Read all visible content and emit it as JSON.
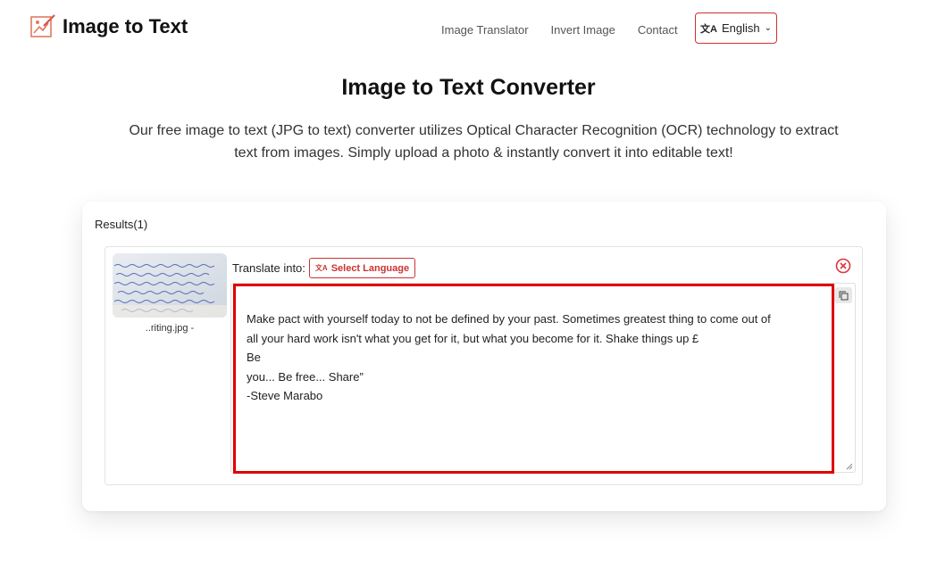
{
  "header": {
    "logo_text": "Image to Text",
    "nav": [
      {
        "label": "Image Translator"
      },
      {
        "label": "Invert Image"
      },
      {
        "label": "Contact"
      }
    ],
    "language_button": "English"
  },
  "main": {
    "title": "Image to Text Converter",
    "description": "Our free image to text (JPG to text) converter utilizes Optical Character Recognition (OCR) technology to extract text from images. Simply upload a photo & instantly convert it into editable text!"
  },
  "results": {
    "label": "Results(1)",
    "items": [
      {
        "file_name": "..riting.jpg -",
        "translate_label": "Translate into:",
        "select_language": "Select Language",
        "text": "Make pact with yourself today to not be defined by your past. Sometimes greatest thing to come out of\nall your hard work isn't what you get for it, but what you become for it. Shake things up £\nBe\nyou... Be free... Share”\n-Steve Marabo"
      }
    ]
  },
  "colors": {
    "accent": "#cc3333",
    "highlight_border": "#dd0000"
  }
}
